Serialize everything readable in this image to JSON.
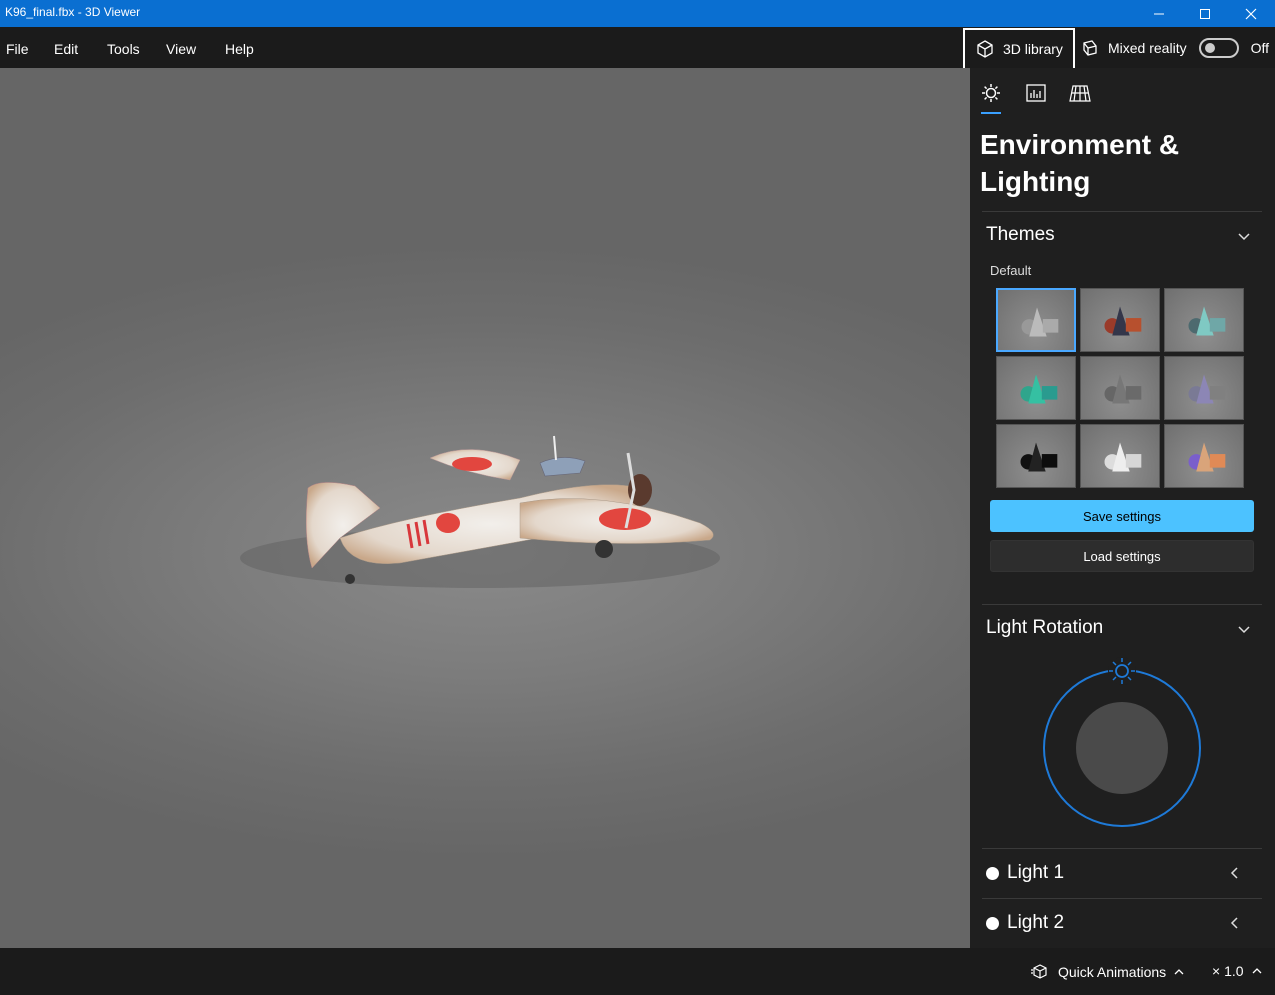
{
  "window": {
    "title": "K96_final.fbx - 3D Viewer"
  },
  "menu": {
    "items": [
      "File",
      "Edit",
      "Tools",
      "View",
      "Help"
    ]
  },
  "toolbar": {
    "library_label": "3D library",
    "mixed_reality_label": "Mixed reality",
    "mixed_reality_state": "Off"
  },
  "panel": {
    "heading": "Environment & Lighting",
    "themes_title": "Themes",
    "themes_sublabel": "Default",
    "save_label": "Save settings",
    "load_label": "Load settings",
    "light_rotation_title": "Light Rotation",
    "lights": [
      "Light 1",
      "Light 2"
    ]
  },
  "status": {
    "quick_animations_label": "Quick Animations",
    "speed_label": "× 1.0"
  },
  "colors": {
    "accent": "#4cc2ff",
    "titlebar": "#0a6fd1",
    "dial": "#1e7ad8"
  }
}
